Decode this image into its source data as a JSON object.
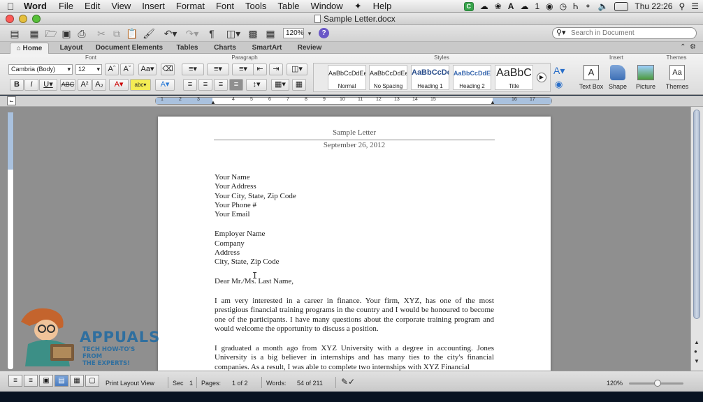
{
  "menubar": {
    "app": "Word",
    "items": [
      "File",
      "Edit",
      "View",
      "Insert",
      "Format",
      "Font",
      "Tools",
      "Table",
      "Window",
      "Help"
    ],
    "cloud_count": "1",
    "clock": "Thu 22:26"
  },
  "window": {
    "title": "Sample Letter.docx"
  },
  "toolbar": {
    "zoom": "120%",
    "search_placeholder": "Search in Document"
  },
  "tabs": [
    "Home",
    "Layout",
    "Document Elements",
    "Tables",
    "Charts",
    "SmartArt",
    "Review"
  ],
  "ribbon": {
    "groups": {
      "font": "Font",
      "paragraph": "Paragraph",
      "styles": "Styles",
      "insert": "Insert",
      "themes": "Themes"
    },
    "font_name": "Cambria (Body)",
    "font_size": "12",
    "styles": [
      {
        "sample": "AaBbCcDdEe",
        "name": "Normal"
      },
      {
        "sample": "AaBbCcDdEe",
        "name": "No Spacing"
      },
      {
        "sample": "AaBbCcDc",
        "name": "Heading 1"
      },
      {
        "sample": "AaBbCcDdEe",
        "name": "Heading 2"
      },
      {
        "sample": "AaBbC",
        "name": "Title"
      }
    ],
    "insert": [
      "Text Box",
      "Shape",
      "Picture"
    ],
    "themes_label": "Themes"
  },
  "ruler": {
    "numbers": [
      "1",
      "2",
      "3",
      "4",
      "5",
      "6",
      "7",
      "8",
      "9",
      "10",
      "11",
      "12",
      "13",
      "14",
      "15",
      "16",
      "17"
    ]
  },
  "document": {
    "header_title": "Sample Letter",
    "header_date": "September 26, 2012",
    "sender": [
      "Your Name",
      "Your Address",
      "Your City, State, Zip Code",
      "Your Phone #",
      "Your Email"
    ],
    "recipient": [
      "Employer Name",
      "Company",
      "Address",
      "City, State, Zip Code"
    ],
    "salutation": "Dear Mr./Ms. Last Name,",
    "paragraph1": "I am very interested in a career in finance. Your firm, XYZ, has one of the most prestigious financial training programs in the country and I would be honoured to become one of the participants. I have many questions about the corporate training program and would welcome the opportunity to discuss a position.",
    "paragraph2": "I graduated a month ago from XYZ University with a degree in accounting. Jones University is a big believer in internships and has many ties to the city's financial companies. As a result, I was able to complete two internships with XYZ Financial"
  },
  "watermark": {
    "brand": "APPUALS",
    "tagline_1": "TECH HOW-TO'S FROM",
    "tagline_2": "THE EXPERTS!"
  },
  "statusbar": {
    "view": "Print Layout View",
    "sec_label": "Sec",
    "sec_value": "1",
    "pages_label": "Pages:",
    "pages_value": "1 of 2",
    "words_label": "Words:",
    "words_value": "54 of 211",
    "zoom": "120%"
  }
}
